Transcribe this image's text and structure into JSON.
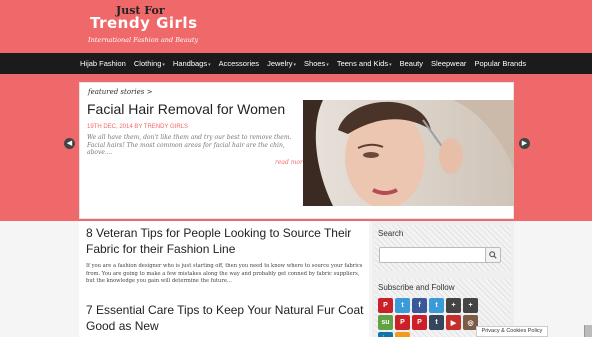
{
  "site": {
    "logo_line1": "Just For",
    "logo_line2": "Trendy Girls",
    "tagline": "International Fashion and Beauty"
  },
  "nav": {
    "items": [
      {
        "label": "Hijab Fashion",
        "dropdown": false
      },
      {
        "label": "Clothing",
        "dropdown": true
      },
      {
        "label": "Handbags",
        "dropdown": true
      },
      {
        "label": "Accessories",
        "dropdown": false
      },
      {
        "label": "Jewelry",
        "dropdown": true
      },
      {
        "label": "Shoes",
        "dropdown": true
      },
      {
        "label": "Teens and Kids",
        "dropdown": true
      },
      {
        "label": "Beauty",
        "dropdown": false
      },
      {
        "label": "Sleepwear",
        "dropdown": false
      },
      {
        "label": "Popular Brands",
        "dropdown": false
      }
    ]
  },
  "featured": {
    "label": "featured stories >",
    "title": "Facial Hair Removal for Women",
    "meta": "19TH DEC, 2014 BY TRENDY GIRLS",
    "excerpt": "We all have them, don't like them and try our best to remove them. Facial hairs! The most common areas for facial hair are the chin, above....",
    "read_more": "read more",
    "image_icon": "woman-tweezing-eyebrows-photo"
  },
  "slider": {
    "prev_icon": "chevron-left-icon",
    "next_icon": "chevron-right-icon"
  },
  "posts": [
    {
      "title": "8 Veteran Tips for People Looking to Source Their Fabric for their Fashion Line",
      "excerpt": "If you are a fashion designer who is just starting off, then you need to know where to source your fabrics from. You are going to make a few mistakes along the way and probably get conned by fabric suppliers, but the knowledge you gain will determine the future..."
    },
    {
      "title": "7 Essential Care Tips to Keep Your Natural Fur Coat Good as New"
    }
  ],
  "sidebar": {
    "search_title": "Search",
    "search_placeholder": "",
    "search_icon": "search-icon",
    "social_title": "Subscribe and Follow",
    "social": [
      {
        "name": "pinterest",
        "glyph": "P",
        "color": "#cb2027"
      },
      {
        "name": "twitter",
        "glyph": "t",
        "color": "#3a9bd9"
      },
      {
        "name": "facebook",
        "glyph": "f",
        "color": "#3b5998"
      },
      {
        "name": "twitter-alt",
        "glyph": "t",
        "color": "#3a9bd9"
      },
      {
        "name": "google-plus",
        "glyph": "+",
        "color": "#444444"
      },
      {
        "name": "share",
        "glyph": "+",
        "color": "#444444"
      },
      {
        "name": "stumbleupon",
        "glyph": "su",
        "color": "#5fa344"
      },
      {
        "name": "pinterest-alt",
        "glyph": "P",
        "color": "#cb2027"
      },
      {
        "name": "pinterest-2",
        "glyph": "P",
        "color": "#cb2027"
      },
      {
        "name": "tumblr",
        "glyph": "t",
        "color": "#35465c"
      },
      {
        "name": "youtube",
        "glyph": "▶",
        "color": "#c4302b"
      },
      {
        "name": "instagram",
        "glyph": "◎",
        "color": "#7a5c47"
      },
      {
        "name": "linkedin",
        "glyph": "in",
        "color": "#0e76a8"
      },
      {
        "name": "rss",
        "glyph": "◥",
        "color": "#f29a1d"
      }
    ]
  },
  "privacy": {
    "label": "Privacy & Cookies Policy"
  },
  "colors": {
    "accent": "#f0696a",
    "nav_bg": "#1b1b1b"
  }
}
